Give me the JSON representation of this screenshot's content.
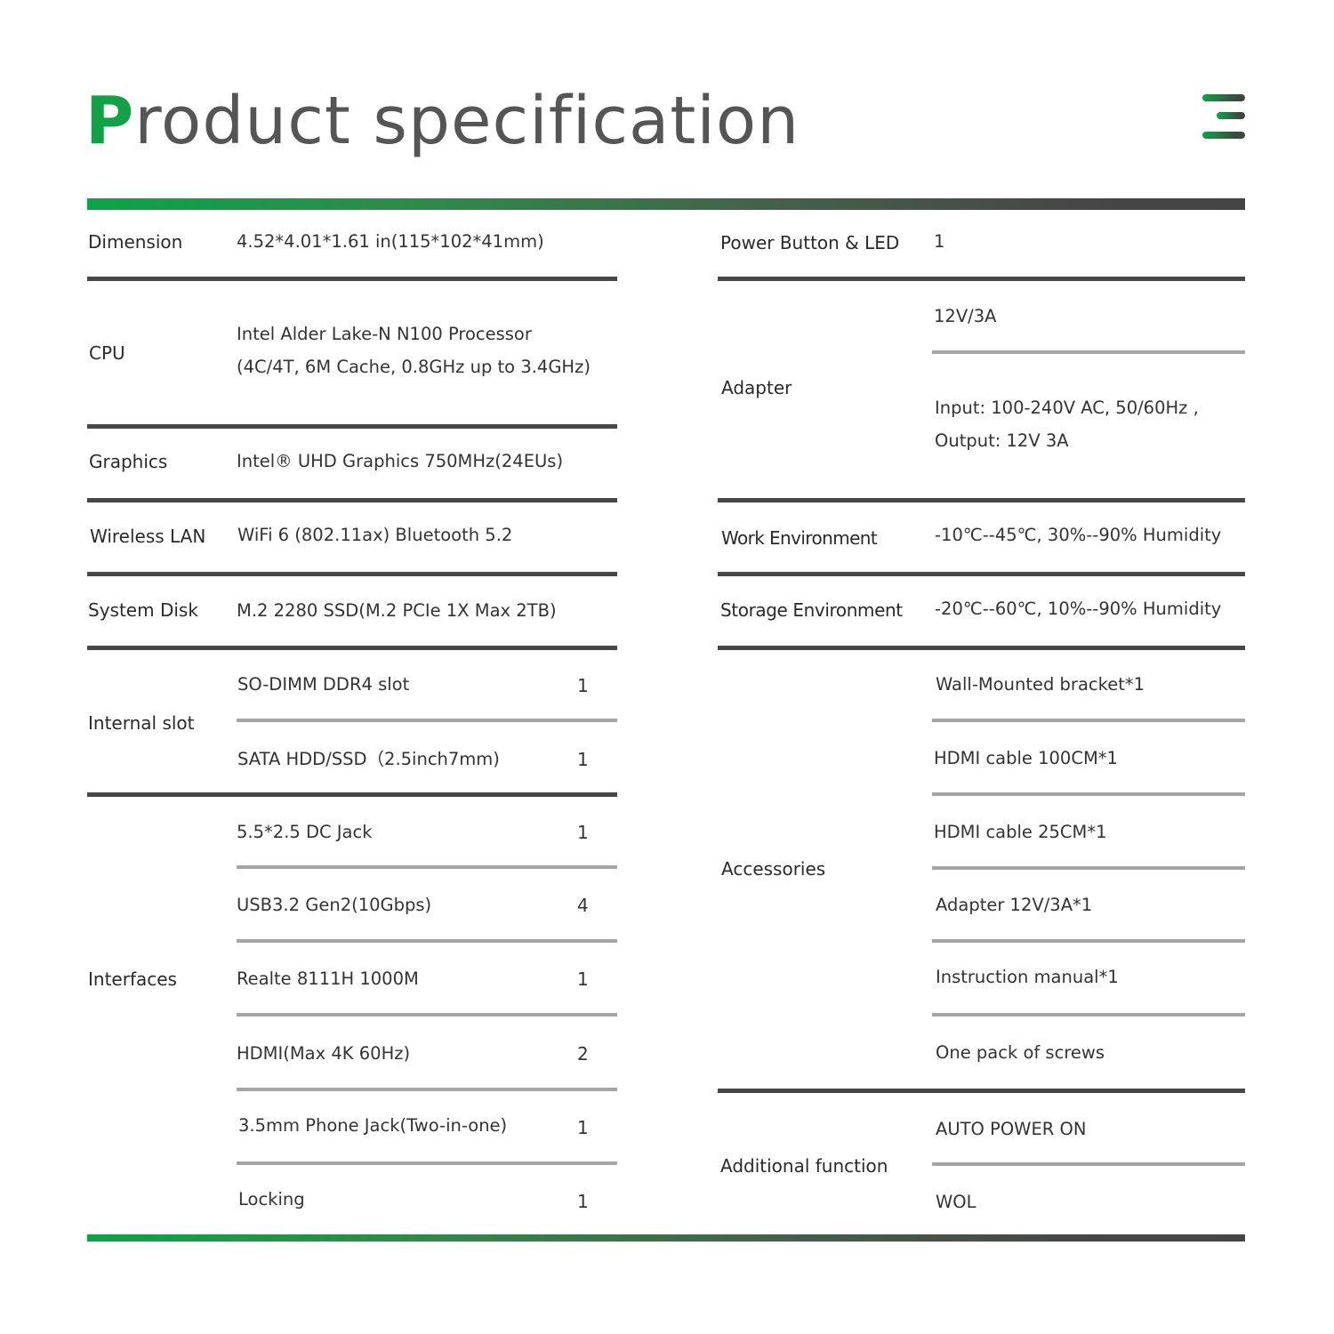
{
  "header": {
    "title_first_letter": "P",
    "title_rest": "roduct specification",
    "menu_icon": "menu-icon",
    "accent_color": "#10a245"
  },
  "left": {
    "dimension": {
      "label": "Dimension",
      "value": "4.52*4.01*1.61 in(115*102*41mm)"
    },
    "cpu": {
      "label": "CPU",
      "line1": "Intel Alder Lake-N N100 Processor",
      "line2": "(4C/4T, 6M Cache, 0.8GHz up to 3.4GHz)"
    },
    "graphics": {
      "label": "Graphics",
      "value": "Intel® UHD Graphics 750MHz(24EUs)"
    },
    "wireless": {
      "label": "Wireless LAN",
      "value": "WiFi 6 (802.11ax)  Bluetooth 5.2"
    },
    "system_disk": {
      "label": "System Disk",
      "value": "M.2  2280 SSD(M.2 PCIe 1X Max 2TB)"
    },
    "internal_slot": {
      "label": "Internal slot",
      "items": [
        {
          "name": "SO-DIMM DDR4 slot",
          "count": "1"
        },
        {
          "name": "SATA HDD/SSD（2.5inch7mm)",
          "count": "1"
        }
      ]
    },
    "interfaces": {
      "label": "Interfaces",
      "items": [
        {
          "name": "5.5*2.5 DC Jack",
          "count": "1"
        },
        {
          "name": "USB3.2 Gen2(10Gbps)",
          "count": "4"
        },
        {
          "name": "Realte 8111H 1000M",
          "count": "1"
        },
        {
          "name": "HDMI(Max 4K 60Hz)",
          "count": "2"
        },
        {
          "name": "3.5mm Phone Jack(Two-in-one)",
          "count": "1"
        },
        {
          "name": "Locking",
          "count": "1"
        }
      ]
    }
  },
  "right": {
    "power_button": {
      "label": "Power Button & LED",
      "value": "1"
    },
    "adapter": {
      "label": "Adapter",
      "rating": "12V/3A",
      "line1": "Input: 100-240V AC, 50/60Hz ,",
      "line2": "Output: 12V 3A"
    },
    "work_env": {
      "label": "Work Environment",
      "value": "-10℃--45℃,  30%--90% Humidity"
    },
    "storage_env": {
      "label": "Storage Environment",
      "value": "-20℃--60℃,  10%--90% Humidity"
    },
    "accessories": {
      "label": "Accessories",
      "items": [
        "Wall-Mounted bracket*1",
        "HDMI cable 100CM*1",
        "HDMI cable 25CM*1",
        "Adapter 12V/3A*1",
        "Instruction manual*1",
        "One pack of screws"
      ]
    },
    "additional": {
      "label": "Additional function",
      "items": [
        "AUTO POWER ON",
        "WOL"
      ]
    }
  }
}
